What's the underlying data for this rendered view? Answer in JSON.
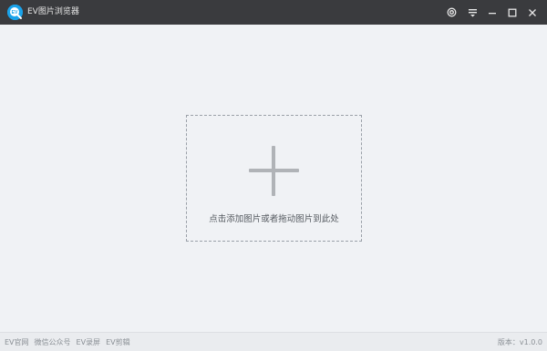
{
  "titlebar": {
    "app_name": "EV图片浏览器",
    "logo_icon": "ev-logo-icon",
    "buttons": [
      {
        "name": "settings-button",
        "icon": "settings-icon"
      },
      {
        "name": "menu-button",
        "icon": "menu-dropdown-icon"
      },
      {
        "name": "minimize-button",
        "icon": "minimize-icon"
      },
      {
        "name": "maximize-button",
        "icon": "maximize-icon"
      },
      {
        "name": "close-button",
        "icon": "close-icon"
      }
    ]
  },
  "main": {
    "drop_zone_text": "点击添加图片或者拖动图片到此处",
    "add_icon": "plus-icon"
  },
  "statusbar": {
    "links": [
      "EV官网",
      "微信公众号",
      "EV录屏",
      "EV剪辑"
    ],
    "version": "版本：v1.0.0"
  },
  "colors": {
    "titlebar_bg": "#3a3b3e",
    "content_bg": "#f0f2f5",
    "logo_accent": "#1aa3ea"
  }
}
